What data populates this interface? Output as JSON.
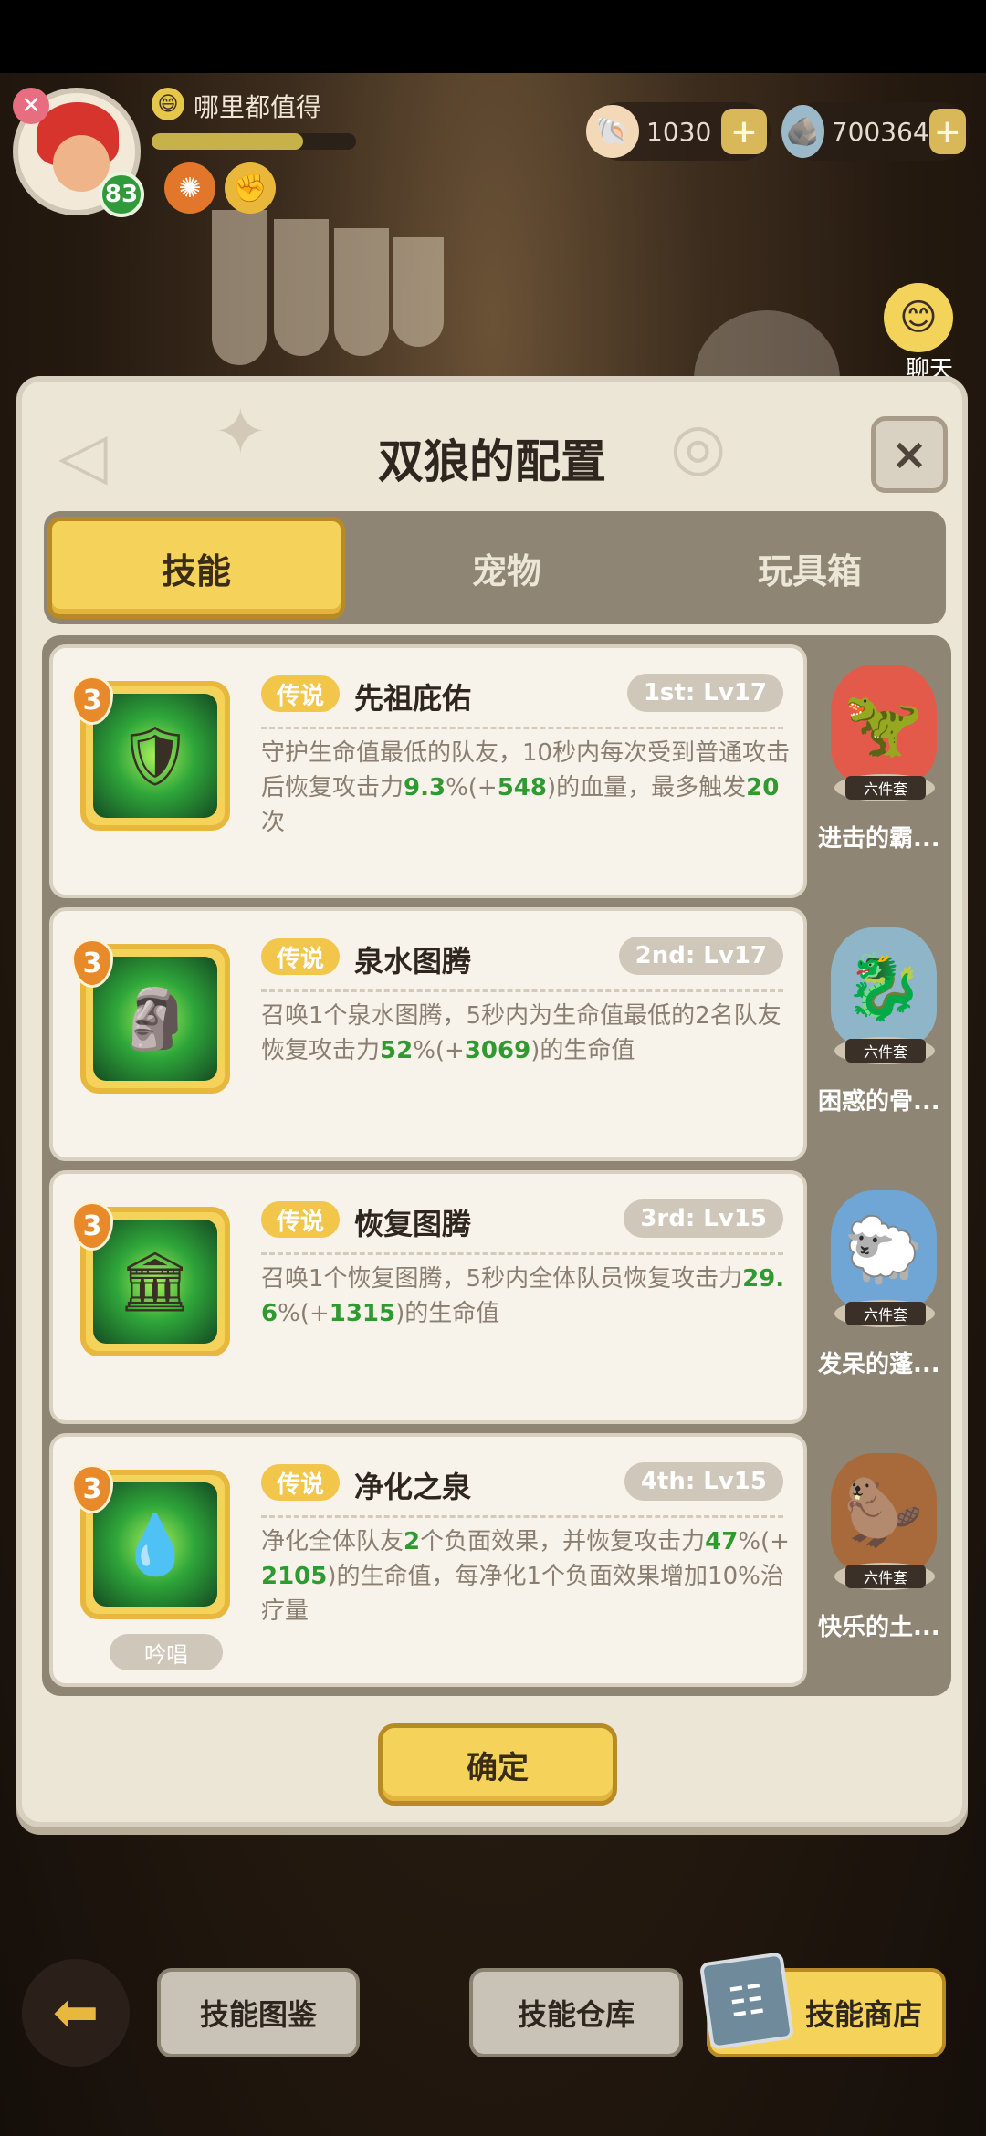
{
  "player": {
    "name": "哪里都值得",
    "level": "83",
    "exp_fraction": 0.74
  },
  "resources": [
    {
      "icon": "shell-icon",
      "value": "1030"
    },
    {
      "icon": "stone-icon",
      "value": "700364"
    }
  ],
  "chat": {
    "label": "聊天"
  },
  "dialog": {
    "title": "双狼的配置",
    "close_label": "×",
    "tabs": [
      {
        "label": "技能",
        "active": true
      },
      {
        "label": "宠物",
        "active": false
      },
      {
        "label": "玩具箱",
        "active": false
      }
    ],
    "confirm_label": "确定"
  },
  "skills": [
    {
      "stars": "3",
      "rarity": "传说",
      "name": "先祖庇佑",
      "slot": "1st: Lv17",
      "desc_parts": [
        "守护生命值最低的队友，10秒内每次受到普通攻击后恢复攻击力",
        "9.3",
        "%(+",
        "548",
        ")的血量，最多触发",
        "20",
        "次"
      ],
      "icon": "shield-icon"
    },
    {
      "stars": "3",
      "rarity": "传说",
      "name": "泉水图腾",
      "slot": "2nd: Lv17",
      "desc_parts": [
        "召唤1个泉水图腾，5秒内为生命值最低的2名队友恢复攻击力",
        "52",
        "%(+",
        "3069",
        ")的生命值"
      ],
      "icon": "totem-icon"
    },
    {
      "stars": "3",
      "rarity": "传说",
      "name": "恢复图腾",
      "slot": "3rd: Lv15",
      "desc_parts": [
        "召唤1个恢复图腾，5秒内全体队员恢复攻击力",
        "29.6",
        "%(+",
        "1315",
        ")的生命值"
      ],
      "icon": "pillar-icon"
    },
    {
      "stars": "3",
      "rarity": "传说",
      "name": "净化之泉",
      "slot": "4th: Lv15",
      "desc_parts": [
        "净化全体队友",
        "2",
        "个负面效果，并恢复攻击力",
        "47",
        "%(+",
        "2105",
        ")的生命值，每净化1个负面效果增加10%治疗量"
      ],
      "chant": "吟唱",
      "icon": "water-drop-icon"
    }
  ],
  "pets": [
    {
      "name": "进击的霸...",
      "set": "六件套",
      "icon": "dino-icon"
    },
    {
      "name": "困惑的骨...",
      "set": "六件套",
      "icon": "dragon-icon"
    },
    {
      "name": "发呆的蓬...",
      "set": "六件套",
      "icon": "sheep-icon"
    },
    {
      "name": "快乐的土...",
      "set": "六件套",
      "icon": "mole-icon"
    }
  ],
  "bottom": {
    "guide": "技能图鉴",
    "store": "技能仓库",
    "shop": "技能商店"
  }
}
